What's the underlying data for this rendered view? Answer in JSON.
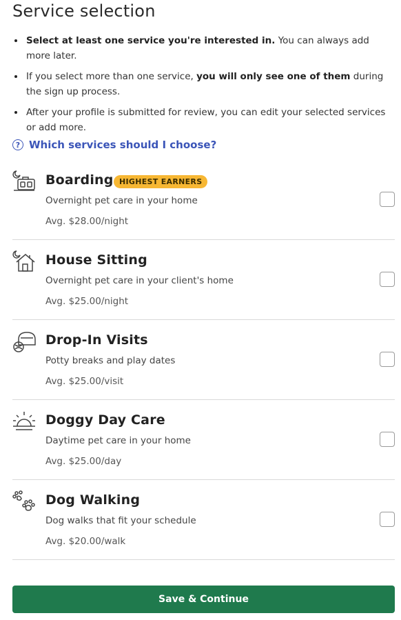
{
  "page": {
    "title": "Service selection"
  },
  "bullets": {
    "b1_bold": "Select at least one service you're interested in.",
    "b1_rest": " You can always add more later.",
    "b2_pre": "If you select more than one service, ",
    "b2_bold": "you will only see one of them",
    "b2_post": " during the sign up process.",
    "b3": "After your profile is submitted for review, you can edit your selected services or add more."
  },
  "help": {
    "icon": "question-circle-icon",
    "label": "Which services should I choose?"
  },
  "services": [
    {
      "name": "Boarding",
      "badge": "HIGHEST EARNERS",
      "description": "Overnight pet care in your home",
      "price": "Avg. $28.00/night",
      "icon": "boarding-icon"
    },
    {
      "name": "House Sitting",
      "description": "Overnight pet care in your client's home",
      "price": "Avg. $25.00/night",
      "icon": "house-sitting-icon"
    },
    {
      "name": "Drop-In Visits",
      "description": "Potty breaks and play dates",
      "price": "Avg. $25.00/visit",
      "icon": "drop-in-icon"
    },
    {
      "name": "Doggy Day Care",
      "description": "Daytime pet care in your home",
      "price": "Avg. $25.00/day",
      "icon": "sun-icon"
    },
    {
      "name": "Dog Walking",
      "description": "Dog walks that fit your schedule",
      "price": "Avg. $20.00/walk",
      "icon": "paw-prints-icon"
    }
  ],
  "footer": {
    "save_label": "Save & Continue"
  },
  "colors": {
    "accent": "#1f7a4d",
    "link": "#3b55b8",
    "badge": "#f7b733"
  }
}
